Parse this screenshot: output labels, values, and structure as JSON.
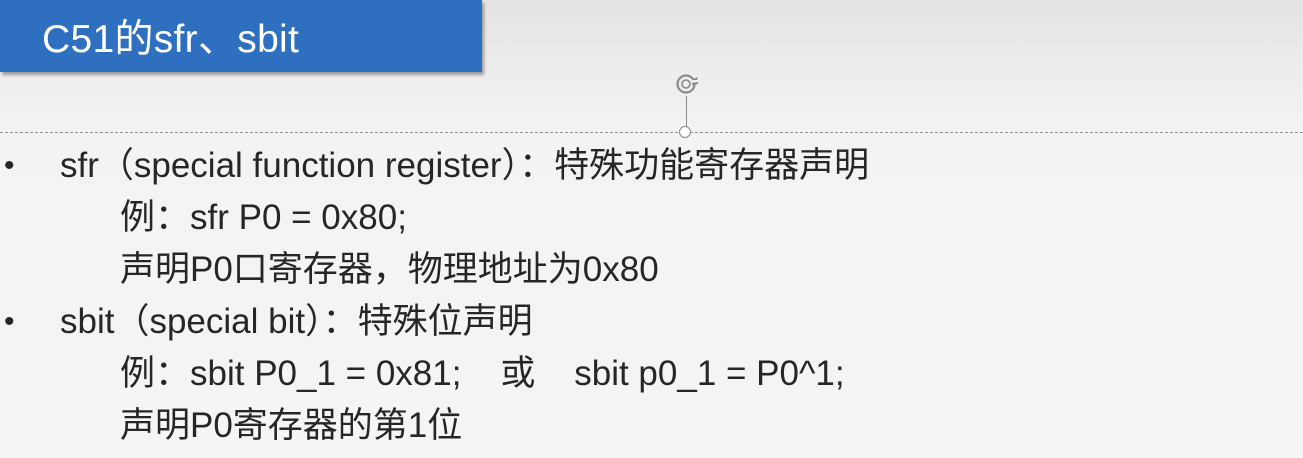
{
  "slide": {
    "title": "C51的sfr、sbit",
    "bullet_symbol": "•",
    "items": [
      {
        "text": "sfr（special function register）：特殊功能寄存器声明",
        "sub": [
          "例：sfr P0 = 0x80;",
          "声明P0口寄存器，物理地址为0x80"
        ]
      },
      {
        "text": "sbit（special bit）：特殊位声明",
        "sub": [
          "例：sbit P0_1 = 0x81;    或    sbit p0_1 = P0^1;",
          "声明P0寄存器的第1位"
        ]
      }
    ]
  },
  "colors": {
    "title_bar": "#2e6fc0",
    "title_text": "#ffffff",
    "body_text": "#262626"
  },
  "icons": {
    "rotate_handle": "rotate-handle-icon",
    "resize_knob": "resize-knob-icon"
  }
}
